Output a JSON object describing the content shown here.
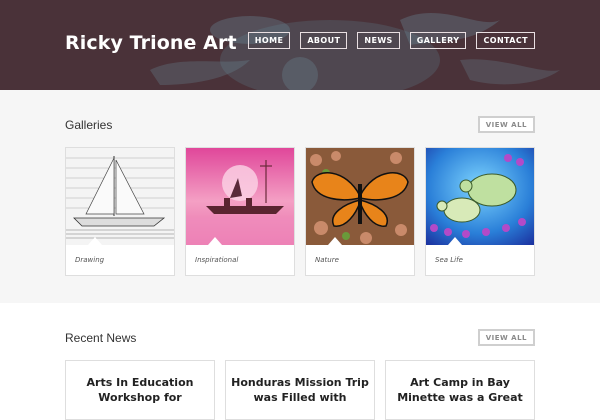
{
  "site": {
    "title": "Ricky Trione Art"
  },
  "nav": {
    "items": [
      "HOME",
      "ABOUT",
      "NEWS",
      "GALLERY",
      "CONTACT"
    ]
  },
  "galleries": {
    "title": "Galleries",
    "view_all_label": "VIEW ALL",
    "items": [
      {
        "caption": "Drawing",
        "image": "sailboat-sketch"
      },
      {
        "caption": "Inspirational",
        "image": "figure-in-boat-pink-sunset"
      },
      {
        "caption": "Nature",
        "image": "monarch-butterfly-on-flowers"
      },
      {
        "caption": "Sea Life",
        "image": "sea-turtles-blue"
      }
    ]
  },
  "news": {
    "title": "Recent News",
    "view_all_label": "VIEW ALL",
    "items": [
      {
        "title_line1": "Arts In Education",
        "title_line2": "Workshop for"
      },
      {
        "title_line1": "Honduras Mission Trip",
        "title_line2": "was Filled with"
      },
      {
        "title_line1": "Art Camp in Bay",
        "title_line2": "Minette was a Great"
      }
    ]
  },
  "colors": {
    "header_bg": "#4a3239",
    "galleries_bg": "#f6f6f6",
    "card_border": "#dedede"
  }
}
